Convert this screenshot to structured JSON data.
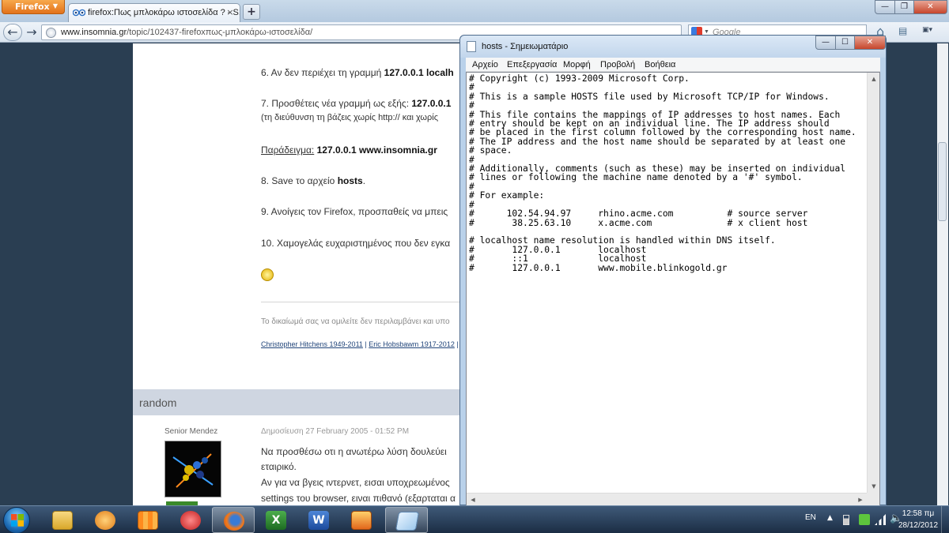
{
  "firefox": {
    "menu_label": "Firefox",
    "tab_title": "firefox:Πως μπλοκάρω ιστοσελίδα ? - S...",
    "tab_close": "×",
    "new_tab": "+",
    "url_host": "www.insomnia.gr",
    "url_path": "/topic/102437-firefoxπως-μπλοκάρω-ιστοσελίδα/",
    "search_placeholder": "Google",
    "window_buttons": {
      "minimize": "—",
      "maximize": "❐",
      "close": "✕"
    }
  },
  "post": {
    "step6": {
      "text": "6. Αν δεν περιέχει τη γραμμή ",
      "bold": "127.0.0.1 localh"
    },
    "step7": {
      "text": "7. Προσθέτεις νέα γραμμή ως εξής: ",
      "bold": "127.0.0.1"
    },
    "step7_note": "(τη διεύθυνση τη βάζεις χωρίς http:// και χωρίς",
    "example_label": "Παράδειγμα:",
    "example_value": "127.0.0.1 www.insomnia.gr",
    "step8": {
      "text": "8. Save το αρχείο ",
      "bold": "hosts",
      "end": "."
    },
    "step9": "9. Ανοίγεις τον Firefox, προσπαθείς να μπεις",
    "step10": "10. Χαμογελάς ευχαριστημένος που δεν εγκα",
    "signature_text": "Το δικαίωμά σας να ομιλείτε δεν περιλαμβάνει και υπο",
    "signature_link1": "Christopher Hitchens 1949-2011",
    "signature_sep": " | ",
    "signature_link2": "Eric Hobsbawm 1917-2012",
    "signature_tail": " |"
  },
  "reply": {
    "section_title": "random",
    "author": "Senior Mendez",
    "date": "Δημοσίευση 27 February 2005 - 01:52 PM",
    "lines": [
      "Να προσθέσω οτι η ανωτέρω λύση δουλεύει ",
      "εταιρικό.",
      "Αν για να βγεις ιντερνετ, εισαι υποχρεωμένος",
      "settings του browser, ειναι πιθανό (εξαρταται α"
    ]
  },
  "notepad": {
    "title": "hosts - Σημειωματάριο",
    "menu": [
      "Αρχείο",
      "Επεξεργασία",
      "Μορφή",
      "Προβολή",
      "Βοήθεια"
    ],
    "content": "# Copyright (c) 1993-2009 Microsoft Corp.\n#\n# This is a sample HOSTS file used by Microsoft TCP/IP for Windows.\n#\n# This file contains the mappings of IP addresses to host names. Each\n# entry should be kept on an individual line. The IP address should\n# be placed in the first column followed by the corresponding host name.\n# The IP address and the host name should be separated by at least one\n# space.\n#\n# Additionally, comments (such as these) may be inserted on individual\n# lines or following the machine name denoted by a '#' symbol.\n#\n# For example:\n#\n#      102.54.94.97     rhino.acme.com          # source server\n#       38.25.63.10     x.acme.com              # x client host\n\n# localhost name resolution is handled within DNS itself.\n#\t127.0.0.1       localhost\n#\t::1             localhost\n#\t127.0.0.1       www.mobile.blinkogold.gr"
  },
  "taskbar": {
    "language": "EN",
    "time": "12:58 πμ",
    "date": "28/12/2012",
    "apps": [
      "file-explorer",
      "media-player",
      "app-orange",
      "app-red",
      "firefox",
      "excel",
      "word",
      "app-toolbox",
      "notepad"
    ]
  }
}
